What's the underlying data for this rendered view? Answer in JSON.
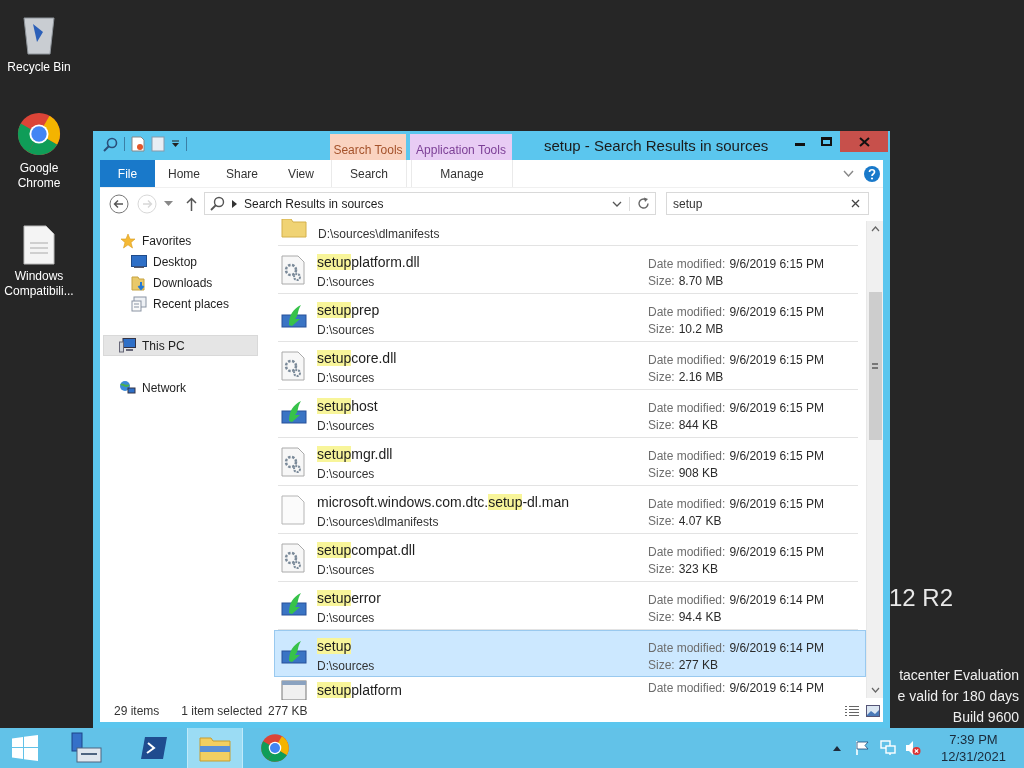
{
  "desktop": {
    "icons": [
      {
        "label": "Recycle Bin",
        "kind": "recycle"
      },
      {
        "label": "Google Chrome",
        "kind": "chrome"
      },
      {
        "label": "Windows Compatibili...",
        "kind": "document"
      }
    ],
    "background_text": {
      "edition": "12 R2",
      "lines": [
        "tacenter Evaluation",
        "e valid for 180 days",
        "Build 9600"
      ]
    }
  },
  "window": {
    "title": "setup - Search Results in sources",
    "ribbon": {
      "file_tab": "File",
      "tabs": [
        "Home",
        "Share",
        "View"
      ],
      "contextual": [
        {
          "label": "Search Tools",
          "tab": "Search",
          "color": "#fad3c0"
        },
        {
          "label": "Application Tools",
          "tab": "Manage",
          "color": "#e8ccf4"
        }
      ]
    },
    "navigation": {
      "back": {
        "disabled": false
      },
      "forward": {
        "disabled": true
      }
    },
    "address": "Search Results in sources",
    "search": {
      "value": "setup"
    },
    "nav_pane": [
      {
        "label": "Favorites",
        "kind": "star",
        "selected": false,
        "children": [
          {
            "label": "Desktop",
            "kind": "desktop",
            "selected": false
          },
          {
            "label": "Downloads",
            "kind": "downloads",
            "selected": false
          },
          {
            "label": "Recent places",
            "kind": "recent",
            "selected": false
          }
        ]
      },
      {
        "label": "This PC",
        "kind": "pc",
        "selected": true
      },
      {
        "label": "Network",
        "kind": "network",
        "selected": false
      }
    ],
    "results_cut_top": {
      "kind": "folder",
      "path": "D:\\sources\\dlmanifests",
      "selected": false
    },
    "results": [
      {
        "kind": "dll",
        "name_parts": [
          {
            "text": "setup",
            "highlight": true
          },
          {
            "text": "platform.dll",
            "highlight": false
          }
        ],
        "path": "D:\\sources",
        "date_label": "Date modified:",
        "date": "9/6/2019 6:15 PM",
        "size_label": "Size:",
        "size": "8.70 MB",
        "selected": false
      },
      {
        "kind": "setup",
        "name_parts": [
          {
            "text": "setup",
            "highlight": true
          },
          {
            "text": "prep",
            "highlight": false
          }
        ],
        "path": "D:\\sources",
        "date_label": "Date modified:",
        "date": "9/6/2019 6:15 PM",
        "size_label": "Size:",
        "size": "10.2 MB",
        "selected": false
      },
      {
        "kind": "dll",
        "name_parts": [
          {
            "text": "setup",
            "highlight": true
          },
          {
            "text": "core.dll",
            "highlight": false
          }
        ],
        "path": "D:\\sources",
        "date_label": "Date modified:",
        "date": "9/6/2019 6:15 PM",
        "size_label": "Size:",
        "size": "2.16 MB",
        "selected": false
      },
      {
        "kind": "setup",
        "name_parts": [
          {
            "text": "setup",
            "highlight": true
          },
          {
            "text": "host",
            "highlight": false
          }
        ],
        "path": "D:\\sources",
        "date_label": "Date modified:",
        "date": "9/6/2019 6:15 PM",
        "size_label": "Size:",
        "size": "844 KB",
        "selected": false
      },
      {
        "kind": "dll",
        "name_parts": [
          {
            "text": "setup",
            "highlight": true
          },
          {
            "text": "mgr.dll",
            "highlight": false
          }
        ],
        "path": "D:\\sources",
        "date_label": "Date modified:",
        "date": "9/6/2019 6:15 PM",
        "size_label": "Size:",
        "size": "908 KB",
        "selected": false
      },
      {
        "kind": "file",
        "name_parts": [
          {
            "text": "microsoft.windows.com.dtc.",
            "highlight": false
          },
          {
            "text": "setup",
            "highlight": true
          },
          {
            "text": "-dl.man",
            "highlight": false
          }
        ],
        "path": "D:\\sources\\dlmanifests",
        "date_label": "Date modified:",
        "date": "9/6/2019 6:15 PM",
        "size_label": "Size:",
        "size": "4.07 KB",
        "selected": false
      },
      {
        "kind": "dll",
        "name_parts": [
          {
            "text": "setup",
            "highlight": true
          },
          {
            "text": "compat.dll",
            "highlight": false
          }
        ],
        "path": "D:\\sources",
        "date_label": "Date modified:",
        "date": "9/6/2019 6:15 PM",
        "size_label": "Size:",
        "size": "323 KB",
        "selected": false
      },
      {
        "kind": "setup",
        "name_parts": [
          {
            "text": "setup",
            "highlight": true
          },
          {
            "text": "error",
            "highlight": false
          }
        ],
        "path": "D:\\sources",
        "date_label": "Date modified:",
        "date": "9/6/2019 6:14 PM",
        "size_label": "Size:",
        "size": "94.4 KB",
        "selected": false
      },
      {
        "kind": "setup",
        "name_parts": [
          {
            "text": "setup",
            "highlight": true
          }
        ],
        "path": "D:\\sources",
        "date_label": "Date modified:",
        "date": "9/6/2019 6:14 PM",
        "size_label": "Size:",
        "size": "277 KB",
        "selected": true
      }
    ],
    "results_cut_bottom": {
      "kind": "window",
      "name_parts": [
        {
          "text": "setup",
          "highlight": true
        },
        {
          "text": "platform",
          "highlight": false
        }
      ],
      "date_label": "Date modified:",
      "date": "9/6/2019 6:14 PM",
      "selected": false
    },
    "status": {
      "count": "29 items",
      "selection": "1 item selected",
      "size": "277 KB"
    }
  },
  "taskbar": {
    "apps": [
      {
        "kind": "server_manager",
        "active": false
      },
      {
        "kind": "powershell",
        "active": false
      },
      {
        "kind": "explorer",
        "active": true
      },
      {
        "kind": "chrome",
        "active": false
      }
    ],
    "clock": {
      "time": "7:39 PM",
      "date": "12/31/2021"
    }
  }
}
